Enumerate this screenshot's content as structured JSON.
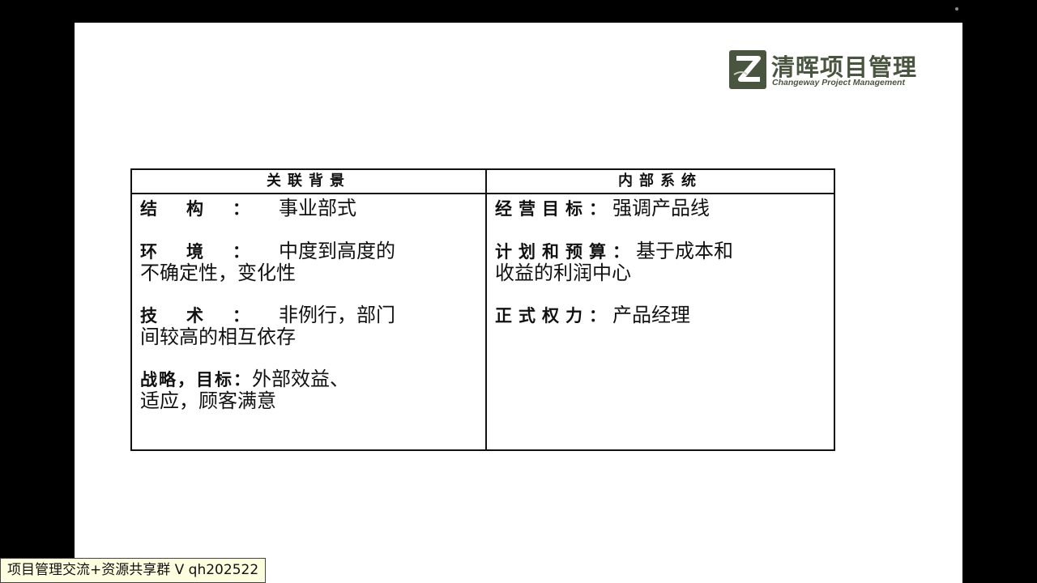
{
  "logo": {
    "cn": "清晖项目管理",
    "en": "Changeway Project Management",
    "color": "#4a5540"
  },
  "table": {
    "left": {
      "header": "关联背景",
      "items": [
        {
          "label": "结构：",
          "value": "事业部式",
          "cont": ""
        },
        {
          "label": "环境：",
          "value": "中度到高度的",
          "cont": "不确定性，变化性"
        },
        {
          "label": "技术：",
          "value": "非例行，部门",
          "cont": "间较高的相互依存"
        },
        {
          "label": "战略，目标：",
          "value": "外部效益、",
          "cont": "适应，顾客满意"
        }
      ]
    },
    "right": {
      "header": "内部系统",
      "items": [
        {
          "label": "经营目标：",
          "value": "强调产品线",
          "cont": ""
        },
        {
          "label": "计划和预算：",
          "value": "基于成本和",
          "cont": "收益的利润中心"
        },
        {
          "label": "正式权力：",
          "value": "产品经理",
          "cont": ""
        }
      ]
    }
  },
  "watermark": {
    "text": "项目管理交流+资源共享群 V qh202522"
  }
}
